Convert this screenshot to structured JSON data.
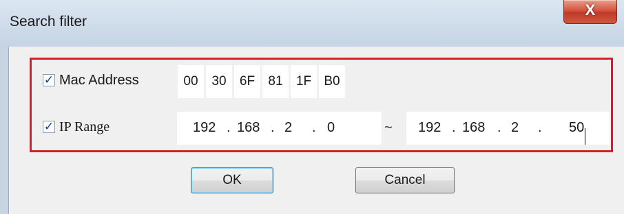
{
  "dialog": {
    "title": "Search filter",
    "close_label": "X"
  },
  "mac_row": {
    "checked": true,
    "label": "Mac Address",
    "octets": [
      "00",
      "30",
      "6F",
      "81",
      "1F",
      "B0"
    ]
  },
  "ip_row": {
    "checked": true,
    "label": "IP Range",
    "from": [
      "192",
      "168",
      "2",
      "0"
    ],
    "separator": "~",
    "to": [
      "192",
      "168",
      "2",
      "50"
    ]
  },
  "buttons": {
    "ok": "OK",
    "cancel": "Cancel"
  },
  "colors": {
    "highlight_border": "#d21f2b",
    "close_button": "#c0392b"
  }
}
